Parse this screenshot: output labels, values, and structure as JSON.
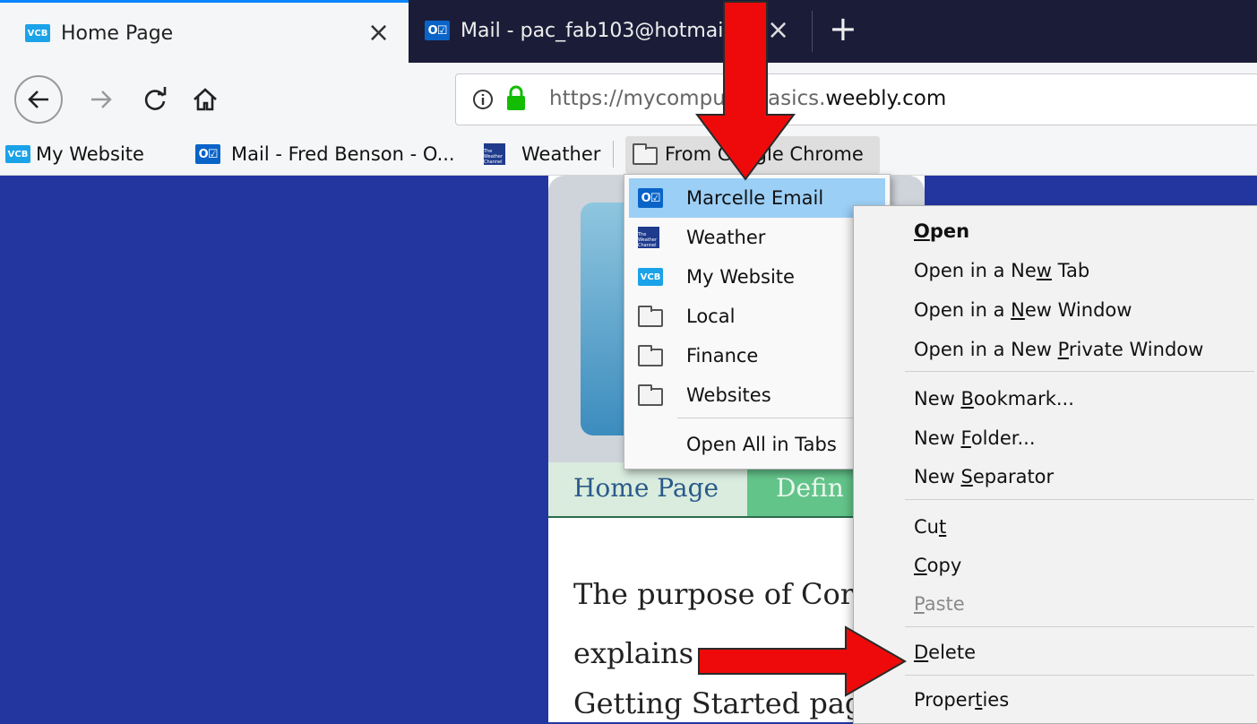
{
  "tabs": [
    {
      "label": "Home Page",
      "icon": "vcb-icon",
      "active": true
    },
    {
      "label": "Mail - pac_fab103@hotmai",
      "icon": "outlook-icon",
      "active": false
    }
  ],
  "new_tab_symbol": "+",
  "close_symbol": "×",
  "address": {
    "prefix": "https://mycomp",
    "hidden_part": "uter",
    "middle": "basics.",
    "domain": "weebly.com"
  },
  "bookmarks_bar": [
    {
      "label": "My Website",
      "icon": "vcb-icon"
    },
    {
      "label": "Mail - Fred Benson - O...",
      "icon": "outlook-icon"
    },
    {
      "label": "Weather",
      "icon": "weather-channel-icon"
    },
    {
      "label": "From Google Chrome",
      "icon": "folder-icon"
    }
  ],
  "icon_text": {
    "vcb": "VCB",
    "outlook": "O☑",
    "weather": "The Weather Channel"
  },
  "folder_menu": {
    "items": [
      {
        "label": "Marcelle Email",
        "icon": "outlook-icon",
        "highlighted": true
      },
      {
        "label": "Weather",
        "icon": "weather-channel-icon"
      },
      {
        "label": "My Website",
        "icon": "vcb-icon"
      },
      {
        "label": "Local",
        "icon": "folder-icon"
      },
      {
        "label": "Finance",
        "icon": "folder-icon"
      },
      {
        "label": "Websites",
        "icon": "folder-icon"
      }
    ],
    "open_all": "Open All in Tabs"
  },
  "context_menu": {
    "open": {
      "pre": "",
      "key": "O",
      "post": "pen"
    },
    "open_new_tab": {
      "pre": "Open in a Ne",
      "key": "w",
      "post": " Tab"
    },
    "open_new_window": {
      "pre": "Open in a ",
      "key": "N",
      "post": "ew Window"
    },
    "open_private": {
      "pre": "Open in a New ",
      "key": "P",
      "post": "rivate Window"
    },
    "new_bookmark": {
      "pre": "New ",
      "key": "B",
      "post": "ookmark..."
    },
    "new_folder": {
      "pre": "New ",
      "key": "F",
      "post": "older..."
    },
    "new_separator": {
      "pre": "New ",
      "key": "S",
      "post": "eparator"
    },
    "cut": {
      "pre": "Cu",
      "key": "t",
      "post": ""
    },
    "copy": {
      "pre": "",
      "key": "C",
      "post": "opy"
    },
    "paste": {
      "pre": "",
      "key": "P",
      "post": "aste"
    },
    "delete": {
      "pre": "",
      "key": "D",
      "post": "elete"
    },
    "properties": {
      "pre": "Proper",
      "key": "t",
      "post": "ies"
    }
  },
  "site": {
    "nav_home": "Home Page",
    "nav_def": "Defin",
    "body_lines": [
      "The purpose of Cor",
      "explains",
      "Getting Started pag"
    ]
  },
  "colors": {
    "accent": "#0a84ff",
    "annotation_arrow": "#ee0a0a",
    "page_bg": "#2336a0",
    "site_nav_active": "#63c48a"
  }
}
